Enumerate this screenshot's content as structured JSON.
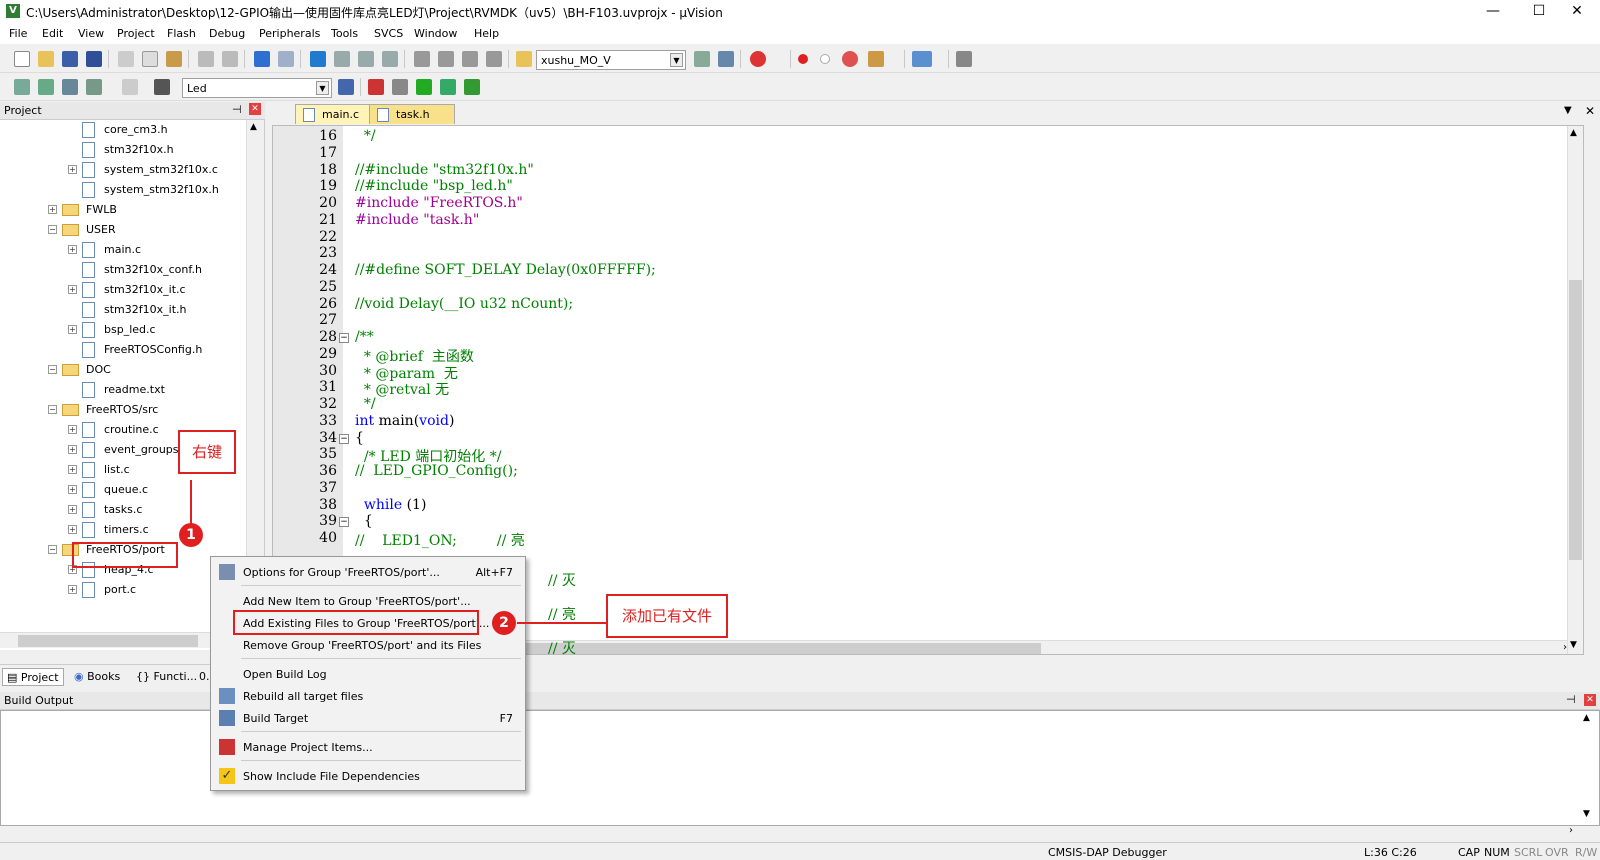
{
  "window": {
    "title": "C:\\Users\\Administrator\\Desktop\\12-GPIO输出—使用固件库点亮LED灯\\Project\\RVMDK（uv5）\\BH-F103.uvprojx - µVision",
    "minimize": "—",
    "maximize": "☐",
    "close": "✕",
    "icon": "V"
  },
  "menu": [
    "File",
    "Edit",
    "View",
    "Project",
    "Flash",
    "Debug",
    "Peripherals",
    "Tools",
    "SVCS",
    "Window",
    "Help"
  ],
  "toolbar": {
    "target_combo": "xushu_MO_V",
    "build_target": "Led"
  },
  "project": {
    "title": "Project",
    "tree": [
      {
        "label": "core_cm3.h",
        "type": "file",
        "expand": ""
      },
      {
        "label": "stm32f10x.h",
        "type": "file",
        "expand": ""
      },
      {
        "label": "system_stm32f10x.c",
        "type": "file",
        "expand": "+"
      },
      {
        "label": "system_stm32f10x.h",
        "type": "file",
        "expand": ""
      },
      {
        "label": "FWLB",
        "type": "folder",
        "expand": "+"
      },
      {
        "label": "USER",
        "type": "folder",
        "expand": "−"
      },
      {
        "label": "main.c",
        "type": "file",
        "expand": "+"
      },
      {
        "label": "stm32f10x_conf.h",
        "type": "file",
        "expand": ""
      },
      {
        "label": "stm32f10x_it.c",
        "type": "file",
        "expand": "+"
      },
      {
        "label": "stm32f10x_it.h",
        "type": "file",
        "expand": ""
      },
      {
        "label": "bsp_led.c",
        "type": "file",
        "expand": "+"
      },
      {
        "label": "FreeRTOSConfig.h",
        "type": "file",
        "expand": ""
      },
      {
        "label": "DOC",
        "type": "folder",
        "expand": "−"
      },
      {
        "label": "readme.txt",
        "type": "file",
        "expand": ""
      },
      {
        "label": "FreeRTOS/src",
        "type": "folder",
        "expand": "−"
      },
      {
        "label": "croutine.c",
        "type": "file",
        "expand": "+"
      },
      {
        "label": "event_groups.c",
        "type": "file",
        "expand": "+"
      },
      {
        "label": "list.c",
        "type": "file",
        "expand": "+"
      },
      {
        "label": "queue.c",
        "type": "file",
        "expand": "+"
      },
      {
        "label": "tasks.c",
        "type": "file",
        "expand": "+"
      },
      {
        "label": "timers.c",
        "type": "file",
        "expand": "+"
      },
      {
        "label": "FreeRTOS/port",
        "type": "folder",
        "expand": "−"
      },
      {
        "label": "heap_4.c",
        "type": "file",
        "expand": "+"
      },
      {
        "label": "port.c",
        "type": "file",
        "expand": "+"
      }
    ],
    "tabs": [
      "Project",
      "Books",
      "{} Functi...",
      "0..."
    ]
  },
  "editor": {
    "tabs": [
      "main.c",
      "task.h"
    ],
    "lines": [
      {
        "n": "16",
        "segs": [
          {
            "c": "cm",
            "t": "  */"
          }
        ]
      },
      {
        "n": "17",
        "segs": []
      },
      {
        "n": "18",
        "segs": [
          {
            "c": "cm",
            "t": "//#include \"stm32f10x.h\""
          }
        ]
      },
      {
        "n": "19",
        "segs": [
          {
            "c": "cm",
            "t": "//#include \"bsp_led.h\""
          }
        ]
      },
      {
        "n": "20",
        "segs": [
          {
            "c": "pp",
            "t": "#include "
          },
          {
            "c": "str",
            "t": "\"FreeRTOS.h\""
          }
        ]
      },
      {
        "n": "21",
        "segs": [
          {
            "c": "pp",
            "t": "#include "
          },
          {
            "c": "str",
            "t": "\"task.h\""
          }
        ]
      },
      {
        "n": "22",
        "segs": []
      },
      {
        "n": "23",
        "segs": []
      },
      {
        "n": "24",
        "segs": [
          {
            "c": "cm",
            "t": "//#define SOFT_DELAY Delay(0x0FFFFF);"
          }
        ]
      },
      {
        "n": "25",
        "segs": []
      },
      {
        "n": "26",
        "segs": [
          {
            "c": "cm",
            "t": "//void Delay(__IO u32 nCount);"
          }
        ]
      },
      {
        "n": "27",
        "segs": []
      },
      {
        "n": "28",
        "segs": [
          {
            "c": "cm",
            "t": "/**"
          }
        ]
      },
      {
        "n": "29",
        "segs": [
          {
            "c": "cm",
            "t": "  * @brief  主函数"
          }
        ]
      },
      {
        "n": "30",
        "segs": [
          {
            "c": "cm",
            "t": "  * @param  无"
          }
        ]
      },
      {
        "n": "31",
        "segs": [
          {
            "c": "cm",
            "t": "  * @retval 无"
          }
        ]
      },
      {
        "n": "32",
        "segs": [
          {
            "c": "cm",
            "t": "  */"
          }
        ]
      },
      {
        "n": "33",
        "segs": [
          {
            "c": "kw",
            "t": "int"
          },
          {
            "c": "tx",
            "t": " main("
          },
          {
            "c": "kw",
            "t": "void"
          },
          {
            "c": "tx",
            "t": ")"
          }
        ]
      },
      {
        "n": "34",
        "segs": [
          {
            "c": "tx",
            "t": "{"
          }
        ]
      },
      {
        "n": "35",
        "segs": [
          {
            "c": "cm",
            "t": "  /* LED 端口初始化 */"
          }
        ]
      },
      {
        "n": "36",
        "segs": [
          {
            "c": "cm",
            "t": "//  LED_GPIO_Config();"
          }
        ]
      },
      {
        "n": "37",
        "segs": []
      },
      {
        "n": "38",
        "segs": [
          {
            "c": "kw",
            "t": "  while"
          },
          {
            "c": "tx",
            "t": " (1)"
          }
        ]
      },
      {
        "n": "39",
        "segs": [
          {
            "c": "tx",
            "t": "  {"
          }
        ]
      },
      {
        "n": "40",
        "segs": [
          {
            "c": "cm",
            "t": "//    LED1_ON;         // 亮"
          }
        ]
      }
    ],
    "hidden_comments": [
      "// 灭",
      "// 亮",
      "// 灭"
    ]
  },
  "context_menu": {
    "items": [
      {
        "label": "Options for Group 'FreeRTOS/port'...",
        "shortcut": "Alt+F7"
      },
      {
        "label": "Add New  Item to Group 'FreeRTOS/port'...",
        "shortcut": ""
      },
      {
        "label": "Add Existing Files to Group 'FreeRTOS/port'...",
        "shortcut": ""
      },
      {
        "label": "Remove Group 'FreeRTOS/port' and its Files",
        "shortcut": ""
      },
      {
        "label": "Open Build Log",
        "shortcut": ""
      },
      {
        "label": "Rebuild all target files",
        "shortcut": ""
      },
      {
        "label": "Build Target",
        "shortcut": "F7"
      },
      {
        "label": "Manage Project Items...",
        "shortcut": ""
      },
      {
        "label": "Show Include File Dependencies",
        "shortcut": ""
      }
    ]
  },
  "annotations": {
    "right_click": "右键",
    "step1": "1",
    "step2": "2",
    "add_existing": "添加已有文件"
  },
  "build": {
    "title": "Build Output"
  },
  "status": {
    "debugger": "CMSIS-DAP Debugger",
    "position": "L:36 C:26",
    "cap": "CAP",
    "num": "NUM",
    "scrl": "SCRL",
    "ovr": "OVR",
    "rw": "R/W"
  }
}
